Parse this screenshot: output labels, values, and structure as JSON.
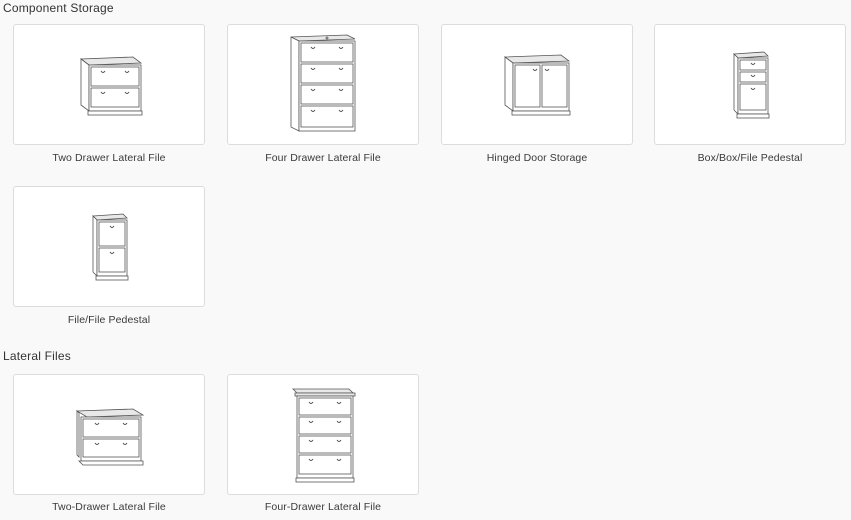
{
  "sections": [
    {
      "title": "Component Storage",
      "items": [
        {
          "label": "Two Drawer Lateral File",
          "icon": "two-drawer-lateral-file-illustration"
        },
        {
          "label": "Four Drawer Lateral File",
          "icon": "four-drawer-lateral-file-illustration"
        },
        {
          "label": "Hinged Door Storage",
          "icon": "hinged-door-storage-illustration"
        },
        {
          "label": "Box/Box/File Pedestal",
          "icon": "box-box-file-pedestal-illustration"
        },
        {
          "label": "File/File Pedestal",
          "icon": "file-file-pedestal-illustration"
        }
      ]
    },
    {
      "title": "Lateral Files",
      "items": [
        {
          "label": "Two-Drawer Lateral File",
          "icon": "two-drawer-lateral-file-illustration"
        },
        {
          "label": "Four-Drawer Lateral File",
          "icon": "four-drawer-lateral-file-illustration"
        }
      ]
    }
  ],
  "colors": {
    "background": "#f9f9f9",
    "card_background": "#ffffff",
    "card_border": "#dcdcdc",
    "text": "#333333"
  }
}
